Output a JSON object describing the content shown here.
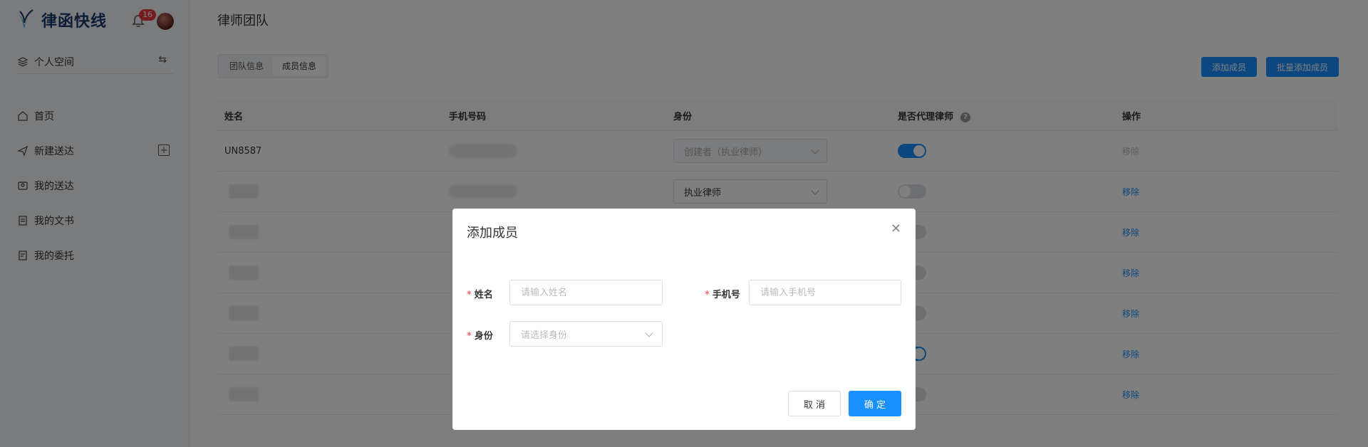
{
  "brand": {
    "name": "律函快线"
  },
  "notifications": {
    "count": "16"
  },
  "sidebar": {
    "space_label": "个人空间",
    "items": [
      {
        "label": "首页",
        "icon": "home-icon"
      },
      {
        "label": "新建送达",
        "icon": "send-icon"
      },
      {
        "label": "我的送达",
        "icon": "delivery-icon"
      },
      {
        "label": "我的文书",
        "icon": "document-icon"
      },
      {
        "label": "我的委托",
        "icon": "commission-icon"
      }
    ]
  },
  "page": {
    "title": "律师团队"
  },
  "tabs": [
    {
      "label": "团队信息",
      "active": false
    },
    {
      "label": "成员信息",
      "active": true
    }
  ],
  "actions": {
    "add_member": "添加成员",
    "batch_add": "批量添加成员"
  },
  "table": {
    "headers": [
      "姓名",
      "手机号码",
      "身份",
      "是否代理律师",
      "操作"
    ],
    "rows": [
      {
        "name": "UN8587",
        "role": "创建者（执业律师）",
        "role_disabled": true,
        "agent": true,
        "op": "移除",
        "op_disabled": true
      },
      {
        "name": "",
        "role": "执业律师",
        "role_disabled": false,
        "agent": false,
        "op": "移除",
        "op_disabled": false
      },
      {
        "name": "",
        "role": "",
        "agent": false,
        "op": "移除",
        "op_disabled": false
      },
      {
        "name": "",
        "role": "",
        "agent": false,
        "op": "移除",
        "op_disabled": false
      },
      {
        "name": "",
        "role": "",
        "agent": false,
        "op": "移除",
        "op_disabled": false
      },
      {
        "name": "",
        "role": "",
        "agent": true,
        "op": "移除",
        "op_disabled": false
      },
      {
        "name": "",
        "role": "",
        "agent": false,
        "op": "移除",
        "op_disabled": false
      }
    ]
  },
  "modal": {
    "title": "添加成员",
    "name_label": "姓名",
    "name_placeholder": "请输入姓名",
    "phone_label": "手机号",
    "phone_placeholder": "请输入手机号",
    "role_label": "身份",
    "role_placeholder": "请选择身份",
    "cancel": "取 消",
    "confirm": "确 定"
  },
  "colors": {
    "primary": "#1890ff",
    "required": "#f56c6c",
    "badge": "#e83b3b"
  }
}
